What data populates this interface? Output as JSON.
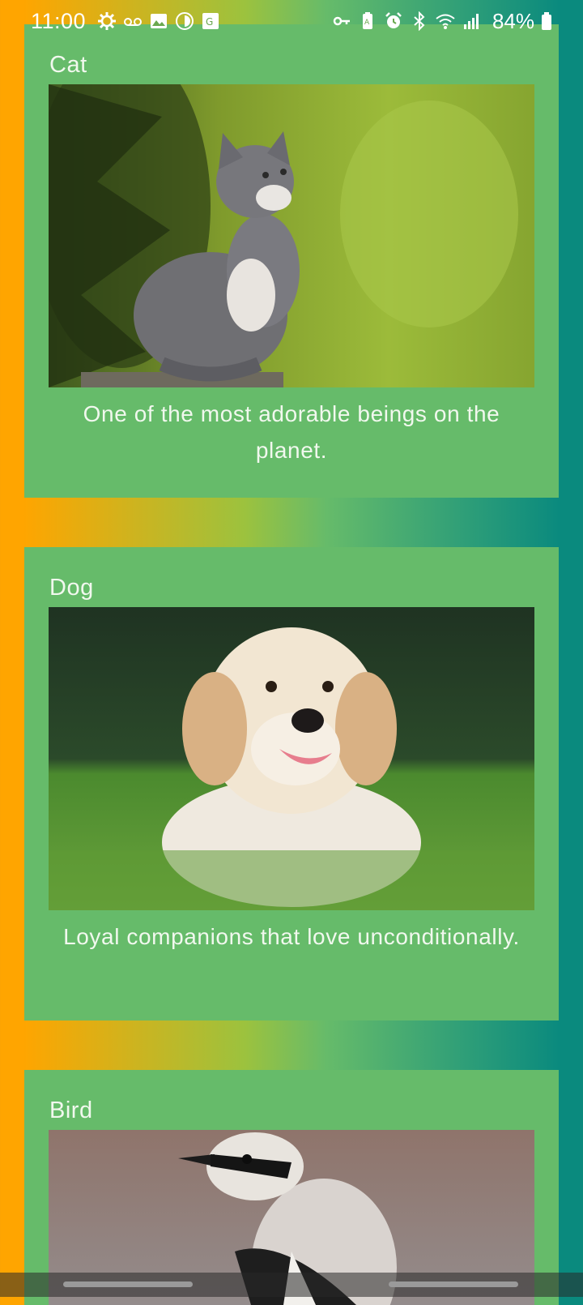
{
  "status_bar": {
    "time": "11:00",
    "battery": "84%",
    "left_icons": [
      "settings-icon",
      "voicemail-icon",
      "gallery-icon",
      "app-icon",
      "translate-icon"
    ],
    "right_icons": [
      "vpn-key-icon",
      "battery-saver-icon",
      "alarm-icon",
      "bluetooth-icon",
      "wifi-icon",
      "signal-icon",
      "battery-icon"
    ]
  },
  "cards": [
    {
      "title": "Cat",
      "image": "cat-photo",
      "description": "One of the most adorable beings on the planet."
    },
    {
      "title": "Dog",
      "image": "dog-photo",
      "description": "Loyal companions that love unconditionally."
    },
    {
      "title": "Bird",
      "image": "bird-photo",
      "description": ""
    }
  ],
  "colors": {
    "card_background": "#66bb6a",
    "gradient_left": "#ffa500",
    "gradient_right": "#0a8a7e",
    "text": "#f1f8ee"
  }
}
